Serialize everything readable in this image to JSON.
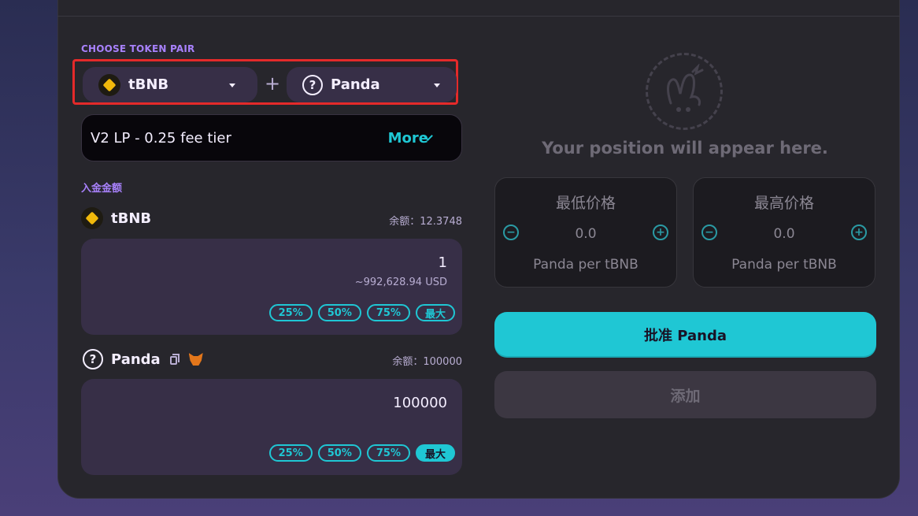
{
  "token_pair": {
    "section_label": "CHOOSE TOKEN PAIR",
    "token_a": {
      "symbol": "tBNB",
      "icon": "bnb-coin-icon"
    },
    "separator": "+",
    "token_b": {
      "symbol": "Panda",
      "icon": "question-mark-icon"
    }
  },
  "fee_tier": {
    "label": "V2 LP - 0.25 fee tier",
    "more_label": "More"
  },
  "deposit": {
    "section_label": "入金金额",
    "token_a": {
      "symbol": "tBNB",
      "balance": "余额：12.3748",
      "amount": "1",
      "usd_value": "~992,628.94 USD",
      "pct_buttons": [
        "25%",
        "50%",
        "75%",
        "最大"
      ]
    },
    "token_b": {
      "symbol": "Panda",
      "balance": "余额：100000",
      "amount": "100000",
      "pct_buttons": [
        "25%",
        "50%",
        "75%",
        "最大"
      ],
      "icons": [
        "copy-icon",
        "metamask-fox-icon"
      ]
    }
  },
  "position": {
    "placeholder_text": "Your position will appear here.",
    "placeholder_icon": "bunny-icon"
  },
  "price_range": {
    "min": {
      "title": "最低价格",
      "value": "0.0",
      "unit": "Panda per tBNB"
    },
    "max": {
      "title": "最高价格",
      "value": "0.0",
      "unit": "Panda per tBNB"
    }
  },
  "actions": {
    "approve_label": "批准 Panda",
    "add_label": "添加"
  },
  "colors": {
    "accent": "#1fc7d4",
    "secondary": "#a881fc",
    "highlight_border": "#e42a2a",
    "card_bg": "#27262c",
    "input_bg": "#372f47"
  }
}
